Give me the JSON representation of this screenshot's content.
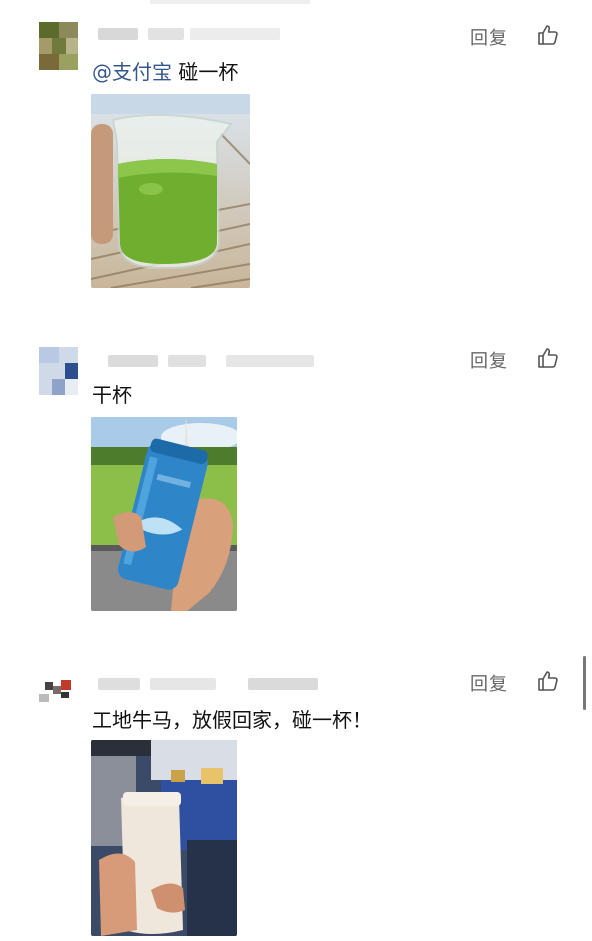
{
  "comments": [
    {
      "mention": "@支付宝",
      "text": " 碰一杯",
      "reply_label": "回复",
      "like_icon": "thumbs-up-icon",
      "photo_desc": "green-drink-in-measuring-cup"
    },
    {
      "mention": "",
      "text": "干杯",
      "reply_label": "回复",
      "like_icon": "thumbs-up-icon",
      "photo_desc": "blue-bottle-in-hand"
    },
    {
      "mention": "",
      "text": "工地牛马，放假回家，碰一杯！",
      "reply_label": "回复",
      "like_icon": "thumbs-up-icon",
      "photo_desc": "white-tumbler-on-train"
    }
  ],
  "colors": {
    "mention": "#36578e",
    "text": "#111111",
    "secondary": "#666666"
  }
}
